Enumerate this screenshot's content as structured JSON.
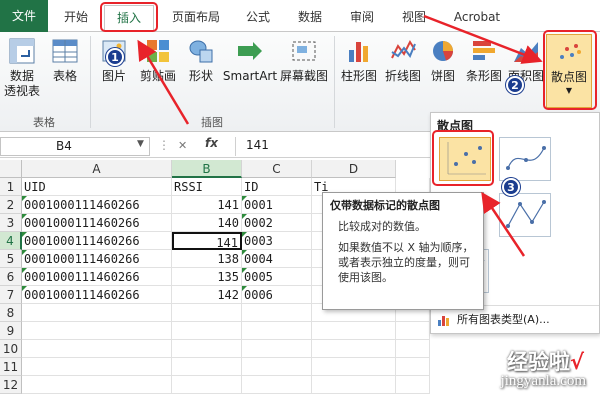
{
  "ribbon_tabs": [
    "文件",
    "开始",
    "插入",
    "页面布局",
    "公式",
    "数据",
    "审阅",
    "视图",
    "Acrobat"
  ],
  "ribbon": {
    "groups": {
      "tables_label": "表格",
      "illustrations_label": "插图"
    },
    "buttons": {
      "pivot_line1": "数据",
      "pivot_line2": "透视表",
      "table": "表格",
      "picture": "图片",
      "clipart": "剪贴画",
      "shapes": "形状",
      "smartart": "SmartArt",
      "screenshot": "屏幕截图",
      "column": "柱形图",
      "line": "折线图",
      "pie": "饼图",
      "bar": "条形图",
      "area": "面积图",
      "scatter": "散点图"
    }
  },
  "formula_bar": {
    "name_box": "B4",
    "fx": "fx",
    "value": "141"
  },
  "sheet": {
    "columns": [
      "A",
      "B",
      "C",
      "D"
    ],
    "rows": [
      [
        "UID",
        "RSSI",
        "ID",
        "Ti"
      ],
      [
        "0001000111460266",
        "141",
        "0001",
        ""
      ],
      [
        "0001000111460266",
        "140",
        "0002",
        ""
      ],
      [
        "0001000111460266",
        "141",
        "0003",
        ""
      ],
      [
        "0001000111460266",
        "138",
        "0004",
        ""
      ],
      [
        "0001000111460266",
        "135",
        "0005",
        ""
      ],
      [
        "0001000111460266",
        "142",
        "0006",
        ""
      ],
      [
        "",
        "",
        "",
        ""
      ],
      [
        "",
        "",
        "",
        ""
      ],
      [
        "",
        "",
        "",
        ""
      ],
      [
        "",
        "",
        "",
        ""
      ],
      [
        "",
        "",
        "",
        ""
      ]
    ],
    "row_numbers": [
      "1",
      "2",
      "3",
      "4",
      "5",
      "6",
      "7",
      "8",
      "9",
      "10",
      "11",
      "12"
    ],
    "active_cell": "B4"
  },
  "scatter_menu": {
    "title": "散点图",
    "all_chart_types": "所有图表类型(A)..."
  },
  "tooltip": {
    "title": "仅带数据标记的散点图",
    "p1": "比较成对的数值。",
    "p2": "如果数值不以 X 轴为顺序，或者表示独立的度量，则可使用该图。"
  },
  "annotations": {
    "badges": [
      "1",
      "2",
      "3"
    ]
  },
  "watermark": {
    "brand": "经验啦",
    "check": "√",
    "url": "jingyanla.com"
  },
  "colors": {
    "excel_green": "#217346",
    "annotation_red": "#e8232a",
    "badge_blue": "#1b3d8f",
    "highlight": "#fbe3a4"
  }
}
